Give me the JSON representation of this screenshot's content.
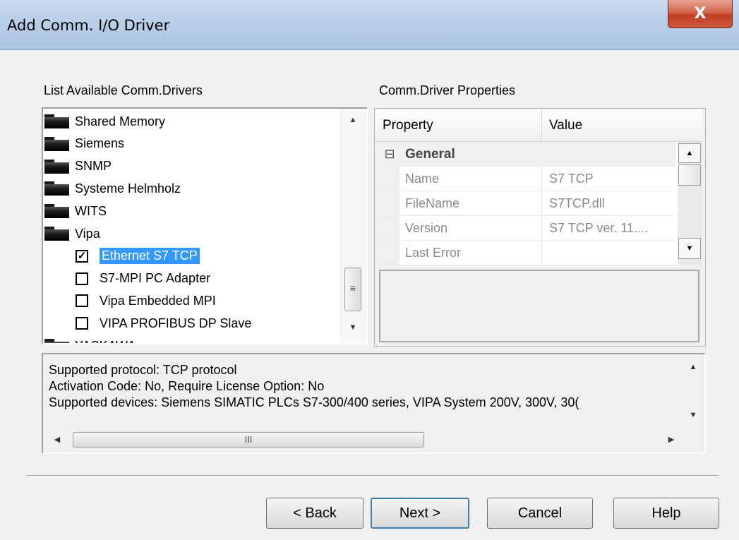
{
  "window": {
    "title": "Add Comm. I/O Driver",
    "close_glyph": "X"
  },
  "left_panel": {
    "label": "List Available Comm.Drivers",
    "items": [
      {
        "label": "Shared Memory",
        "type": "folder"
      },
      {
        "label": "Siemens",
        "type": "folder"
      },
      {
        "label": "SNMP",
        "type": "folder"
      },
      {
        "label": "Systeme Helmholz",
        "type": "folder"
      },
      {
        "label": "WITS",
        "type": "folder"
      },
      {
        "label": "Vipa",
        "type": "folder"
      },
      {
        "label": "Ethernet S7 TCP",
        "type": "checkbox",
        "checked": true,
        "selected": true
      },
      {
        "label": "S7-MPI PC Adapter",
        "type": "checkbox",
        "checked": false
      },
      {
        "label": "Vipa Embedded MPI",
        "type": "checkbox",
        "checked": false
      },
      {
        "label": "VIPA PROFIBUS DP Slave",
        "type": "checkbox",
        "checked": false
      },
      {
        "label": "YASKAWA",
        "type": "folder"
      }
    ]
  },
  "right_panel": {
    "label": "Comm.Driver Properties",
    "headers": {
      "property": "Property",
      "value": "Value"
    },
    "category": {
      "expander": "⊟",
      "name": "General"
    },
    "rows": [
      {
        "property": "Name",
        "value": "S7 TCP"
      },
      {
        "property": "FileName",
        "value": "S7TCP.dll"
      },
      {
        "property": "Version",
        "value": "S7 TCP ver. 11...."
      },
      {
        "property": "Last Error",
        "value": ""
      }
    ]
  },
  "description": {
    "lines": [
      "Supported protocol: TCP protocol",
      "Activation Code: No, Require License Option: No",
      "Supported devices: Siemens SIMATIC PLCs S7-300/400 series, VIPA System 200V, 300V, 30("
    ],
    "hscroll_grip": "III"
  },
  "buttons": {
    "back": "< Back",
    "next": "Next >",
    "cancel": "Cancel",
    "help": "Help"
  },
  "glyphs": {
    "up": "▲",
    "down": "▼",
    "left": "◀",
    "right": "▶",
    "grip": "≡",
    "check": "✓"
  }
}
